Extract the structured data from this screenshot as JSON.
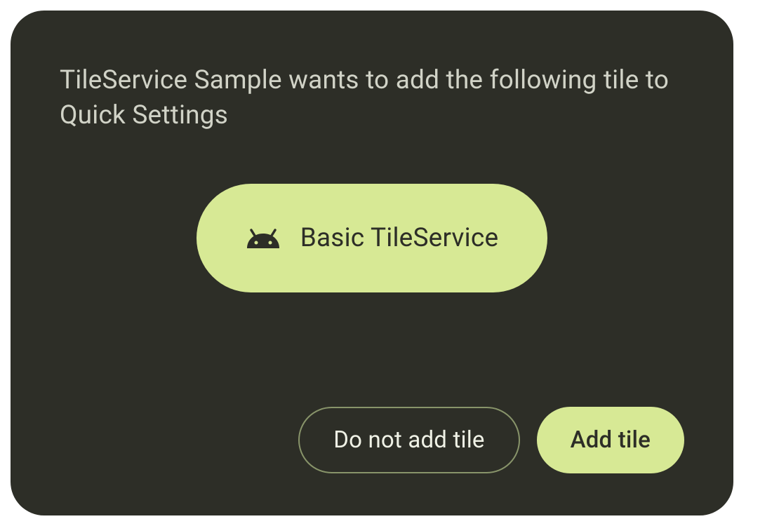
{
  "dialog": {
    "message": "TileService Sample wants to add the following tile to Quick Settings",
    "tile": {
      "label": "Basic TileService",
      "icon": "android-icon"
    },
    "buttons": {
      "cancel": "Do not add tile",
      "confirm": "Add tile"
    }
  },
  "colors": {
    "accent": "#d7e995",
    "background": "#2d2e27",
    "text_light": "#d1d3c7",
    "outline": "#88946a"
  }
}
